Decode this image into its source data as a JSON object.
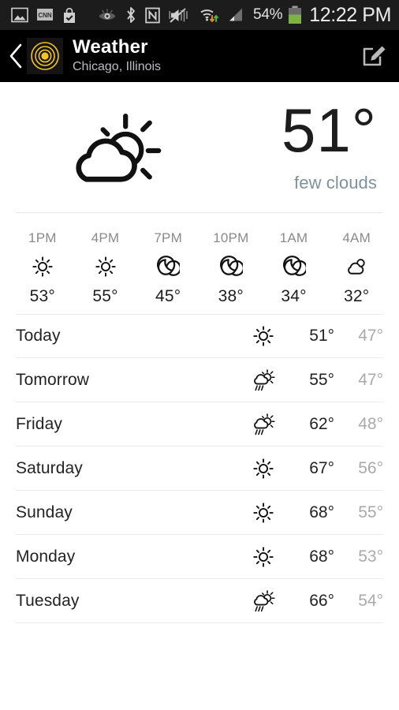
{
  "statusbar": {
    "left_icons": [
      "image-icon",
      "cnn-icon",
      "shopping-bag-check-icon"
    ],
    "mid_icons": [
      "eye-icon",
      "bluetooth-icon",
      "nfc-icon",
      "mute-vibrate-icon",
      "wifi-data-icon",
      "cell-signal-icon"
    ],
    "battery_percent": "54%",
    "battery_icon": "battery-icon",
    "battery_color": "#7cb342",
    "time": "12:22 PM"
  },
  "appbar": {
    "back_icon": "back-chevron-icon",
    "app_icon": "weather-target-icon",
    "app_icon_color": "#f5c518",
    "title": "Weather",
    "subtitle": "Chicago, Illinois",
    "edit_icon": "edit-compose-icon"
  },
  "current": {
    "icon": "cloud-sun-icon",
    "temperature": "51°",
    "description": "few clouds"
  },
  "hourly": [
    {
      "time": "1PM",
      "icon": "sun-icon",
      "temp": "53°"
    },
    {
      "time": "4PM",
      "icon": "sun-icon",
      "temp": "55°"
    },
    {
      "time": "7PM",
      "icon": "moon-icon",
      "temp": "45°"
    },
    {
      "time": "10PM",
      "icon": "moon-icon",
      "temp": "38°"
    },
    {
      "time": "1AM",
      "icon": "moon-icon",
      "temp": "34°"
    },
    {
      "time": "4AM",
      "icon": "cloud-icon",
      "temp": "32°"
    }
  ],
  "daily": [
    {
      "day": "Today",
      "icon": "sun-icon",
      "high": "51°",
      "low": "47°"
    },
    {
      "day": "Tomorrow",
      "icon": "sun-cloud-rain-icon",
      "high": "55°",
      "low": "47°"
    },
    {
      "day": "Friday",
      "icon": "sun-cloud-rain-icon",
      "high": "62°",
      "low": "48°"
    },
    {
      "day": "Saturday",
      "icon": "sun-icon",
      "high": "67°",
      "low": "56°"
    },
    {
      "day": "Sunday",
      "icon": "sun-icon",
      "high": "68°",
      "low": "55°"
    },
    {
      "day": "Monday",
      "icon": "sun-icon",
      "high": "68°",
      "low": "53°"
    },
    {
      "day": "Tuesday",
      "icon": "sun-cloud-rain-icon",
      "high": "66°",
      "low": "54°"
    }
  ]
}
